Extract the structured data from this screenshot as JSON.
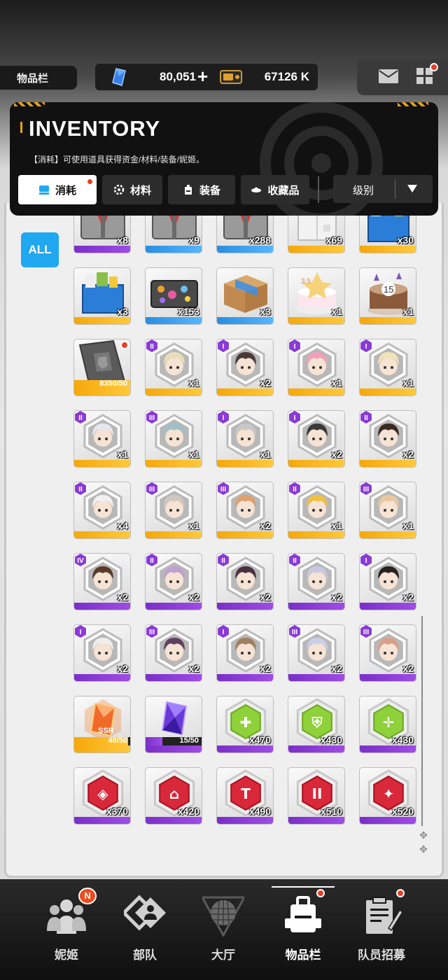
{
  "header": {
    "section_label": "物品栏",
    "gem_amount": "80,051",
    "gem_plus": "+",
    "credit_amount": "67126 K"
  },
  "inventory": {
    "title": "INVENTORY",
    "description": "【消耗】可使用道具获得资金/材料/装备/妮姬。",
    "tabs": [
      {
        "label": "消耗",
        "active": true
      },
      {
        "label": "材料",
        "active": false
      },
      {
        "label": "装备",
        "active": false
      },
      {
        "label": "收藏品",
        "active": false
      }
    ],
    "sort_label": "级别",
    "filter_all": "ALL"
  },
  "items": [
    {
      "count": "x8",
      "bar": "purple",
      "art": "box-gray"
    },
    {
      "count": "x9",
      "bar": "blue",
      "art": "box-gray"
    },
    {
      "count": "x288",
      "bar": "blue",
      "art": "box-gray"
    },
    {
      "count": "x69",
      "bar": "gold",
      "art": "box-white"
    },
    {
      "count": "x30",
      "bar": "gold",
      "art": "box-blue"
    },
    {
      "count": "x3",
      "bar": "gold",
      "art": "box-blue"
    },
    {
      "count": "x153",
      "bar": "blue",
      "art": "case"
    },
    {
      "count": "x3",
      "bar": "blue",
      "art": "cardboard"
    },
    {
      "count": "x1",
      "bar": "gold",
      "art": "cake"
    },
    {
      "count": "x1",
      "bar": "gold",
      "art": "cake2"
    },
    {
      "count": "",
      "bar": "gold",
      "art": "card",
      "progress": "8350/50",
      "progress_fill": 1.0,
      "progress_color": "gold",
      "dot": true
    },
    {
      "count": "x1",
      "bar": "gold",
      "art": "portrait",
      "badge": "II",
      "hair": "#e8dfb8"
    },
    {
      "count": "x2",
      "bar": "gold",
      "art": "portrait",
      "badge": "I",
      "hair": "#4a3a3a"
    },
    {
      "count": "x1",
      "bar": "gold",
      "art": "portrait",
      "badge": "I",
      "hair": "#f0a0b8"
    },
    {
      "count": "x1",
      "bar": "gold",
      "art": "portrait",
      "badge": "I",
      "hair": "#efe2b6"
    },
    {
      "count": "x1",
      "bar": "gold",
      "art": "portrait",
      "badge": "II",
      "hair": "#e6e6ee"
    },
    {
      "count": "x1",
      "bar": "gold",
      "art": "portrait",
      "badge": "III",
      "hair": "#a0c0c8"
    },
    {
      "count": "x1",
      "bar": "gold",
      "art": "portrait",
      "badge": "I",
      "hair": "#c8c8c8"
    },
    {
      "count": "x2",
      "bar": "gold",
      "art": "portrait",
      "badge": "I",
      "hair": "#3a3a3a"
    },
    {
      "count": "x2",
      "bar": "gold",
      "art": "portrait",
      "badge": "II",
      "hair": "#3a2a20"
    },
    {
      "count": "x4",
      "bar": "gold",
      "art": "portrait",
      "badge": "II",
      "hair": "#f0f0f0"
    },
    {
      "count": "x1",
      "bar": "gold",
      "art": "portrait",
      "badge": "III",
      "hair": "#d0c8c0"
    },
    {
      "count": "x2",
      "bar": "gold",
      "art": "portrait",
      "badge": "III",
      "hair": "#e0a070"
    },
    {
      "count": "x1",
      "bar": "gold",
      "art": "portrait",
      "badge": "II",
      "hair": "#f2c040"
    },
    {
      "count": "x1",
      "bar": "gold",
      "art": "portrait",
      "badge": "III",
      "hair": "#e8c8a0"
    },
    {
      "count": "x2",
      "bar": "purple",
      "art": "portrait",
      "badge": "IV",
      "hair": "#5a3a28"
    },
    {
      "count": "x2",
      "bar": "purple",
      "art": "portrait",
      "badge": "II",
      "hair": "#c0a0d0"
    },
    {
      "count": "x2",
      "bar": "purple",
      "art": "portrait",
      "badge": "II",
      "hair": "#4a3040"
    },
    {
      "count": "x2",
      "bar": "purple",
      "art": "portrait",
      "badge": "II",
      "hair": "#c8c8e0"
    },
    {
      "count": "x2",
      "bar": "purple",
      "art": "portrait",
      "badge": "I",
      "hair": "#2a2020"
    },
    {
      "count": "x2",
      "bar": "purple",
      "art": "portrait",
      "badge": "I",
      "hair": "#eeeeee"
    },
    {
      "count": "x2",
      "bar": "purple",
      "art": "portrait",
      "badge": "III",
      "hair": "#604060"
    },
    {
      "count": "x2",
      "bar": "purple",
      "art": "portrait",
      "badge": "I",
      "hair": "#a08060"
    },
    {
      "count": "x2",
      "bar": "purple",
      "art": "portrait",
      "badge": "III",
      "hair": "#c8d0e8"
    },
    {
      "count": "x2",
      "bar": "purple",
      "art": "portrait",
      "badge": "III",
      "hair": "#d8a088"
    },
    {
      "count": "",
      "bar": "gold",
      "art": "crystal-orange",
      "progress": "48/50",
      "progress_fill": 0.96,
      "progress_color": "gold",
      "ssr": "SSR"
    },
    {
      "count": "",
      "bar": "purple",
      "art": "crystal-purple",
      "progress": "15/50",
      "progress_fill": 0.3,
      "progress_color": "purple"
    },
    {
      "count": "x470",
      "bar": "purple",
      "art": "hex-green",
      "sym": "✚"
    },
    {
      "count": "x430",
      "bar": "purple",
      "art": "hex-green",
      "sym": "⛨"
    },
    {
      "count": "x430",
      "bar": "purple",
      "art": "hex-green",
      "sym": "✛"
    },
    {
      "count": "x370",
      "bar": "purple",
      "art": "hex-red",
      "sym": "◈"
    },
    {
      "count": "x420",
      "bar": "purple",
      "art": "hex-red",
      "sym": "⌂"
    },
    {
      "count": "x490",
      "bar": "purple",
      "art": "hex-red",
      "sym": "T"
    },
    {
      "count": "x510",
      "bar": "purple",
      "art": "hex-red",
      "sym": "II"
    },
    {
      "count": "x520",
      "bar": "purple",
      "art": "hex-red",
      "sym": "✦"
    }
  ],
  "nav": [
    {
      "label": "妮姬",
      "icon": "nikke-icon",
      "badge": "N"
    },
    {
      "label": "部队",
      "icon": "squad-icon"
    },
    {
      "label": "大厅",
      "icon": "lobby-icon"
    },
    {
      "label": "物品栏",
      "icon": "inventory-icon",
      "active": true,
      "dot": true
    },
    {
      "label": "队员招募",
      "icon": "recruit-icon",
      "dot": true
    }
  ],
  "colors": {
    "accent_blue": "#20a8f0",
    "rarity_purple": "#8a3ad6",
    "rarity_gold": "#f8b21a",
    "rarity_blue": "#3a9ef0",
    "notify_red": "#e73f26"
  }
}
